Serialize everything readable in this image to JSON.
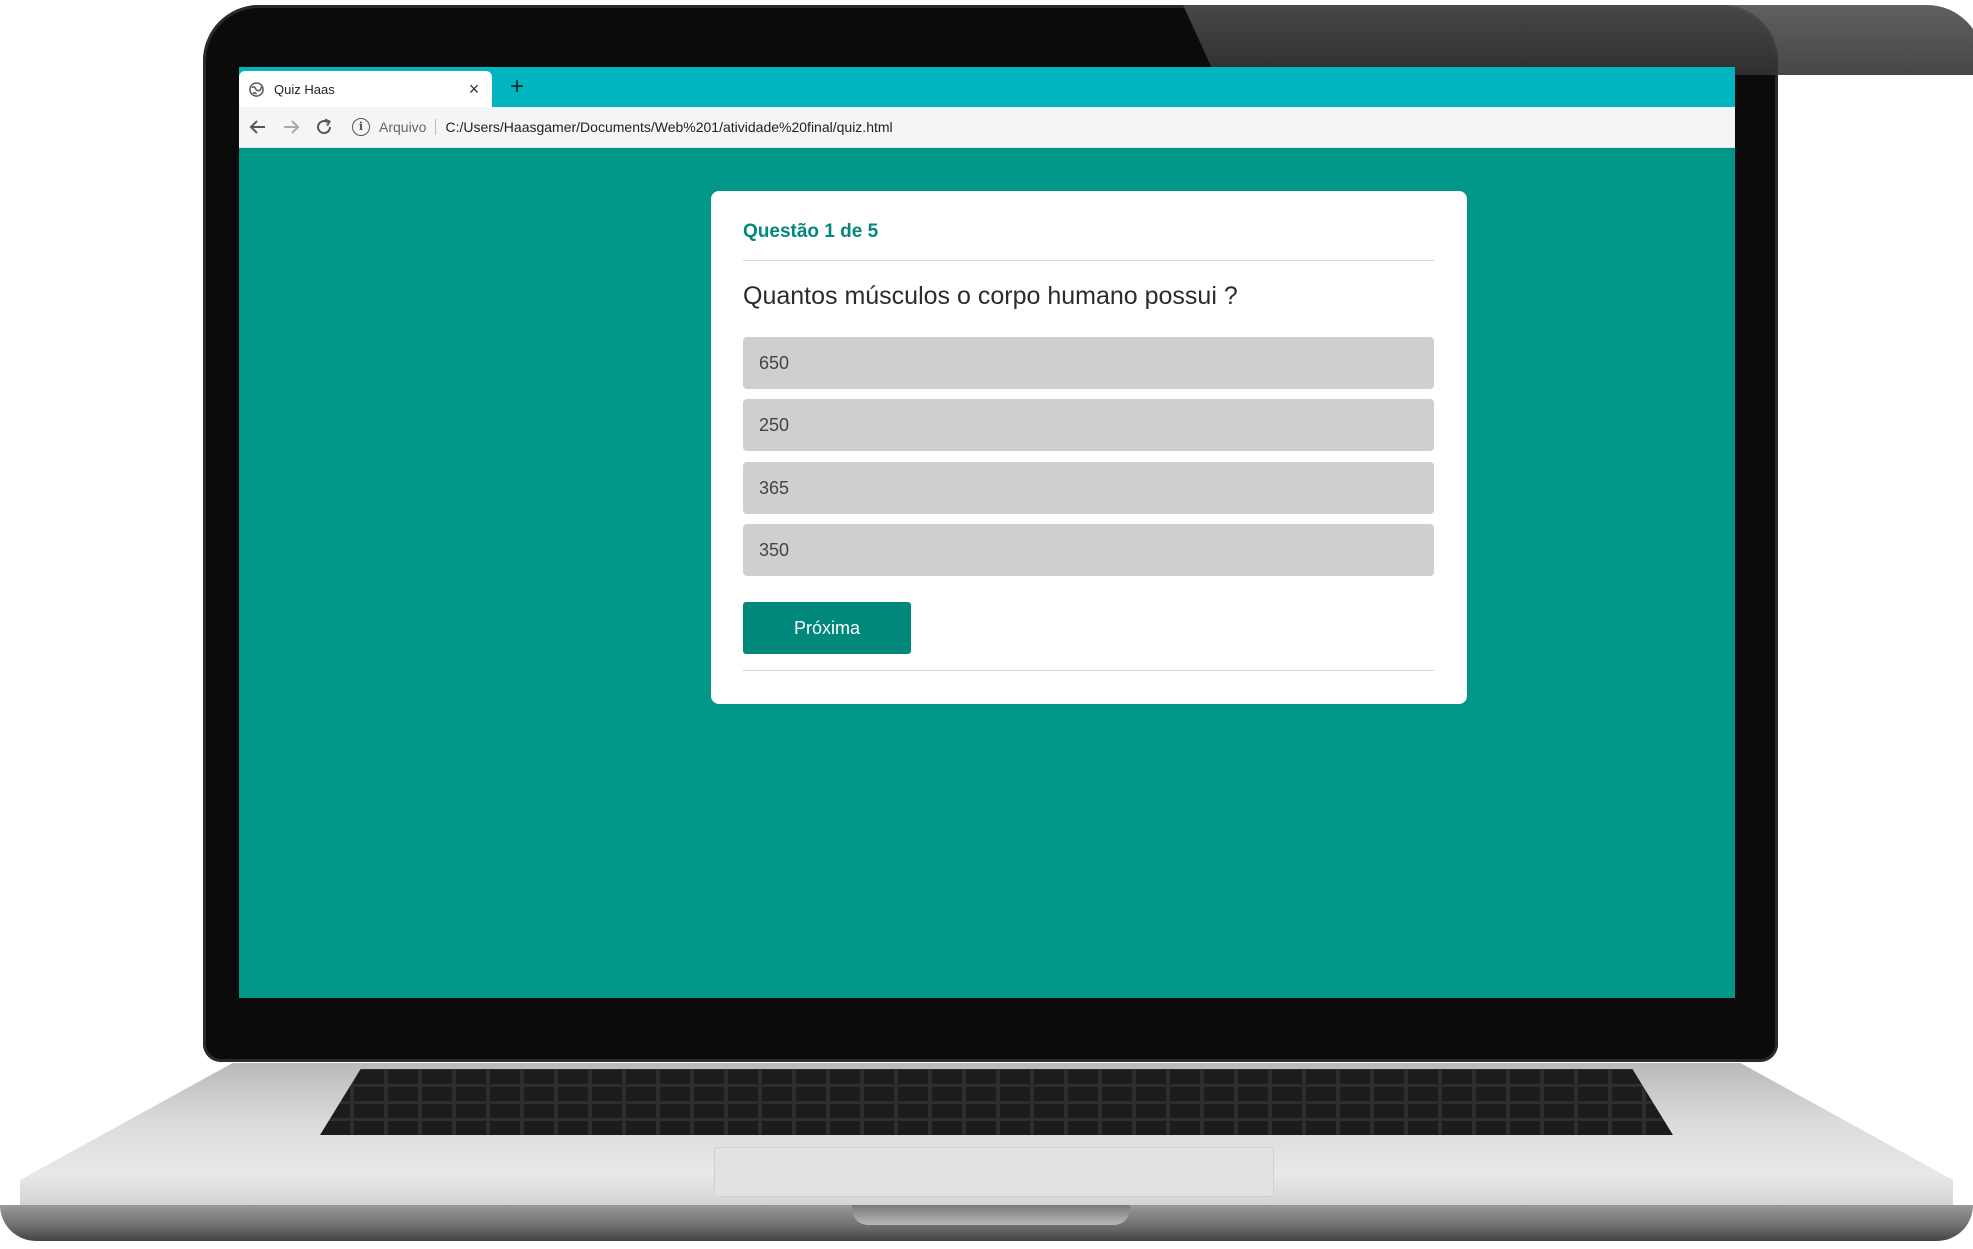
{
  "browser": {
    "tab": {
      "title": "Quiz Haas",
      "close_symbol": "×",
      "icon": "globe-icon"
    },
    "new_tab_symbol": "+",
    "nav": {
      "back_icon": "arrow-left-icon",
      "forward_icon": "arrow-right-icon",
      "reload_icon": "reload-icon"
    },
    "address": {
      "info_symbol": "i",
      "scheme_label": "Arquivo",
      "url": "C:/Users/Haasgamer/Documents/Web%201/atividade%20final/quiz.html"
    },
    "colors": {
      "tab_bar": "#00b5bf",
      "page_background": "#009688"
    }
  },
  "quiz": {
    "counter": "Questão 1 de 5",
    "question": "Quantos músculos o corpo humano possui ?",
    "options": [
      {
        "label": "650"
      },
      {
        "label": "250"
      },
      {
        "label": "365"
      },
      {
        "label": "350"
      }
    ],
    "next_label": "Próxima",
    "colors": {
      "accent": "#00897b",
      "option_background": "#cfcfcf",
      "card_background": "#ffffff"
    }
  }
}
